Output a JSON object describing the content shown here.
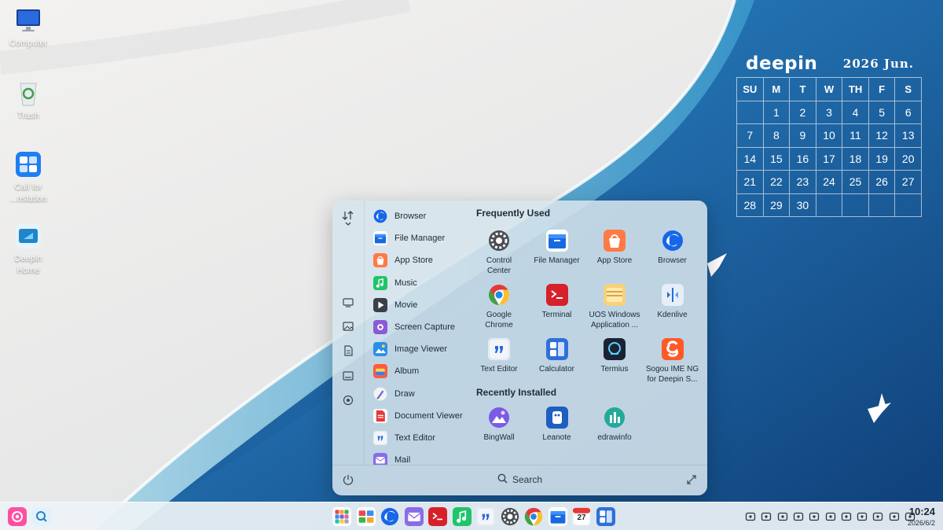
{
  "desktop": {
    "icons": [
      {
        "label": "Computer",
        "icon": "computer-icon"
      },
      {
        "label": "Trash",
        "icon": "trash-icon"
      },
      {
        "label": "Call for",
        "label2": "...nslation",
        "icon": "translation-icon"
      },
      {
        "label": "Deepin",
        "label2": "Home",
        "icon": "deepin-home-icon"
      }
    ]
  },
  "calendar": {
    "brand": "deepin",
    "month": "2026 Jun.",
    "weekdays": [
      "SU",
      "M",
      "T",
      "W",
      "TH",
      "F",
      "S"
    ],
    "days": [
      "",
      "1",
      "2",
      "3",
      "4",
      "5",
      "6",
      "7",
      "8",
      "9",
      "10",
      "11",
      "12",
      "13",
      "14",
      "15",
      "16",
      "17",
      "18",
      "19",
      "20",
      "21",
      "22",
      "23",
      "24",
      "25",
      "26",
      "27",
      "28",
      "29",
      "30",
      "",
      "",
      "",
      ""
    ]
  },
  "launcher": {
    "sort_icon": "sort-icon",
    "categories": [
      "monitor-icon",
      "image-icon",
      "document-icon",
      "terminal-window-icon",
      "settings-gear-icon"
    ],
    "app_list": [
      {
        "label": "Browser",
        "icon": "browser-icon"
      },
      {
        "label": "File Manager",
        "icon": "file-manager-icon"
      },
      {
        "label": "App Store",
        "icon": "app-store-icon"
      },
      {
        "label": "Music",
        "icon": "music-icon"
      },
      {
        "label": "Movie",
        "icon": "movie-icon"
      },
      {
        "label": "Screen Capture",
        "icon": "screen-capture-icon"
      },
      {
        "label": "Image Viewer",
        "icon": "image-viewer-icon"
      },
      {
        "label": "Album",
        "icon": "album-icon"
      },
      {
        "label": "Draw",
        "icon": "draw-icon"
      },
      {
        "label": "Document Viewer",
        "icon": "document-viewer-icon"
      },
      {
        "label": "Text Editor",
        "icon": "text-editor-icon"
      },
      {
        "label": "Mail",
        "icon": "mail-icon"
      }
    ],
    "frequently_used_title": "Frequently Used",
    "frequently_used": [
      {
        "line1": "Control",
        "line2": "Center",
        "icon": "control-center-icon"
      },
      {
        "line1": "File Manager",
        "line2": "",
        "icon": "file-manager-icon"
      },
      {
        "line1": "App Store",
        "line2": "",
        "icon": "app-store-icon"
      },
      {
        "line1": "Browser",
        "line2": "",
        "icon": "browser-icon"
      },
      {
        "line1": "Google",
        "line2": "Chrome",
        "icon": "chrome-icon"
      },
      {
        "line1": "Terminal",
        "line2": "",
        "icon": "terminal-icon"
      },
      {
        "line1": "UOS Windows",
        "line2": "Application ...",
        "icon": "uos-windows-icon"
      },
      {
        "line1": "Kdenlive",
        "line2": "",
        "icon": "kdenlive-icon"
      },
      {
        "line1": "Text Editor",
        "line2": "",
        "icon": "text-editor-icon"
      },
      {
        "line1": "Calculator",
        "line2": "",
        "icon": "calculator-icon"
      },
      {
        "line1": "Termius",
        "line2": "",
        "icon": "termius-icon"
      },
      {
        "line1": "Sogou IME NG",
        "line2": "for Deepin S...",
        "icon": "sogou-icon"
      }
    ],
    "recently_installed_title": "Recently Installed",
    "recently_installed": [
      {
        "line1": "BingWall",
        "icon": "bingwall-icon"
      },
      {
        "line1": "Leanote",
        "icon": "leanote-icon"
      },
      {
        "line1": "edrawinfo",
        "icon": "edrawinfo-icon"
      }
    ],
    "search_label": "Search"
  },
  "taskbar": {
    "left": [
      "launcher-icon",
      "search-icon"
    ],
    "apps": [
      "launchpad-icon",
      "multitask-icon",
      "browser-icon",
      "mail-icon",
      "terminal-icon",
      "music-icon",
      "text-editor-icon",
      "control-center-icon",
      "chrome-icon",
      "file-manager-icon",
      "calendar-icon",
      "calculator-icon"
    ],
    "calendar_day": "27",
    "tray": [
      "keyboard-icon",
      "notification-icon",
      "battery-icon",
      "power-icon",
      "media-icon",
      "usb-icon",
      "sync-icon",
      "wifi-icon",
      "volume-icon",
      "screen-icon",
      "toggle-icon"
    ],
    "time": "10:24",
    "date": "2026/6/2"
  }
}
